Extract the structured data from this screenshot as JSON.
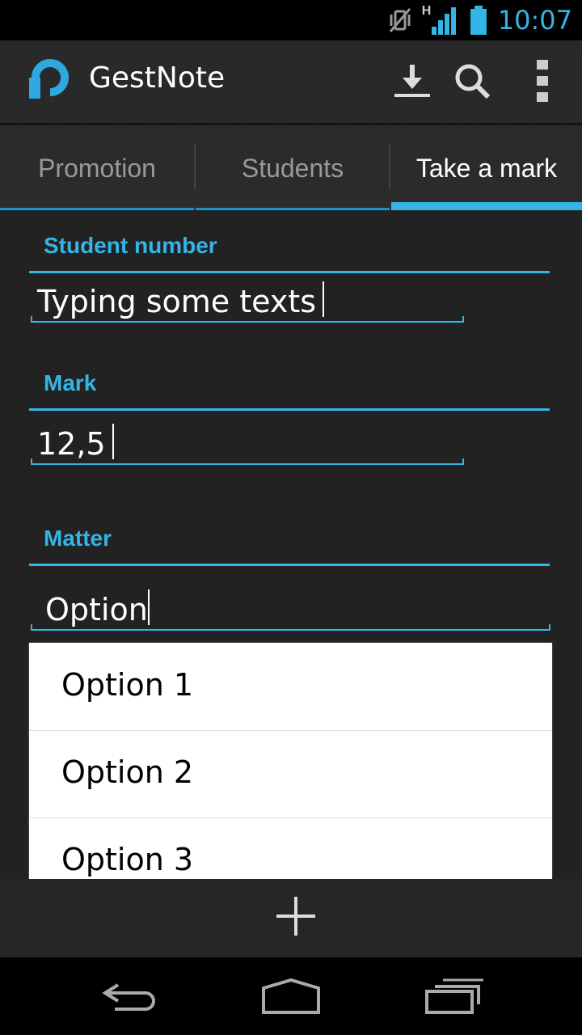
{
  "status_bar": {
    "time": "10:07",
    "network_type": "H",
    "icons": [
      "vibrate-icon",
      "signal-icon",
      "battery-icon"
    ]
  },
  "action_bar": {
    "title": "GestNote",
    "icons": [
      "download-icon",
      "search-icon",
      "overflow-menu-icon"
    ]
  },
  "tabs": [
    {
      "label": "Promotion",
      "active": false
    },
    {
      "label": "Students",
      "active": false
    },
    {
      "label": "Take a mark",
      "active": true
    }
  ],
  "form": {
    "student_number": {
      "label": "Student number",
      "value": "Typing some texts"
    },
    "mark": {
      "label": "Mark",
      "value": "12,5"
    },
    "matter": {
      "label": "Matter",
      "value": "Option"
    }
  },
  "dropdown": {
    "options": [
      "Option 1",
      "Option 2",
      "Option 3"
    ]
  },
  "bottom_bar": {
    "icon": "add-icon"
  },
  "nav_bar": {
    "icons": [
      "back-icon",
      "home-icon",
      "recent-apps-icon"
    ]
  },
  "colors": {
    "accent": "#33b5e5",
    "background": "#222222",
    "status_bar": "#000000"
  }
}
